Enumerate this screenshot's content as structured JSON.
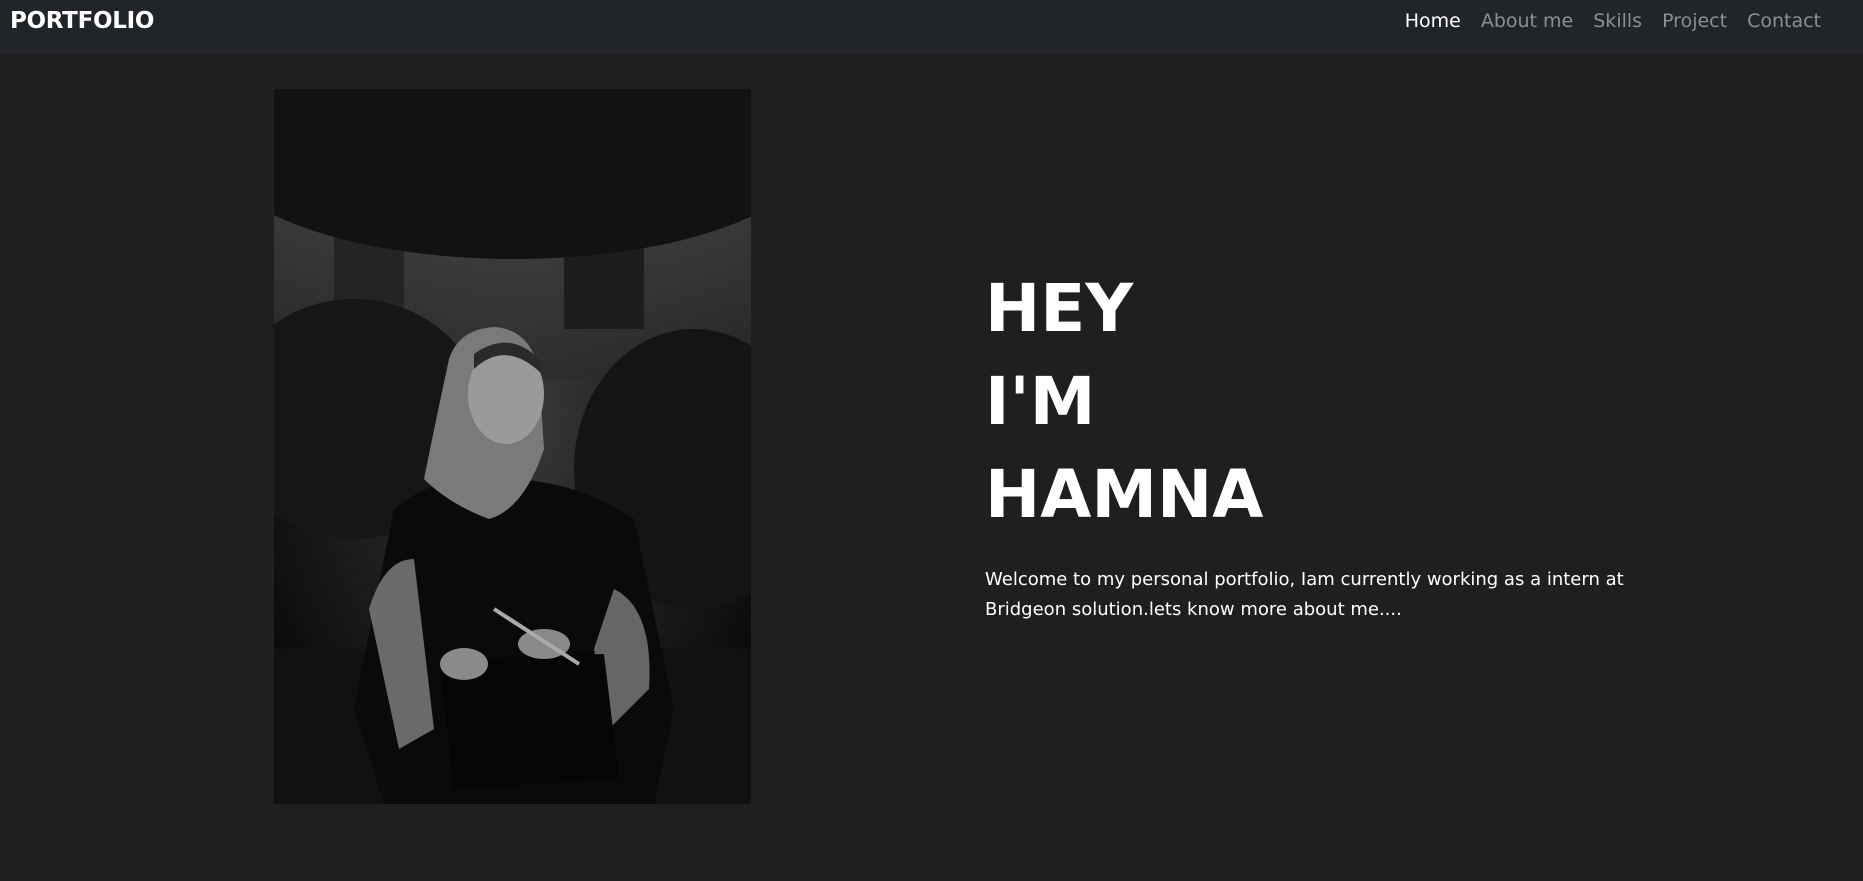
{
  "navbar": {
    "brand": "PORTFOLIO",
    "links": [
      {
        "label": "Home",
        "active": true
      },
      {
        "label": "About me",
        "active": false
      },
      {
        "label": "Skills",
        "active": false
      },
      {
        "label": "Project",
        "active": false
      },
      {
        "label": "Contact",
        "active": false
      }
    ]
  },
  "hero": {
    "title_lines": [
      "HEY",
      "I'M",
      "HAMNA"
    ],
    "intro": "Welcome to my personal portfolio, Iam currently working as a intern at Bridgeon solution.lets know more about me...."
  },
  "colors": {
    "background": "#201f1d",
    "navbar": "#212529",
    "text": "#ffffff",
    "nav_inactive": "#8c8e91"
  }
}
